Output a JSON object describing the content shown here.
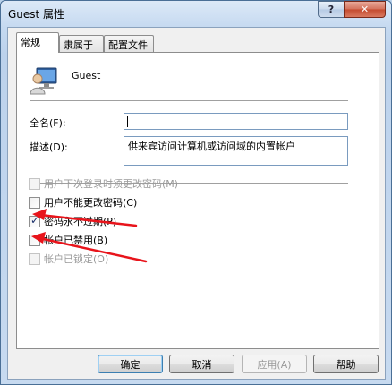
{
  "window": {
    "title": "Guest 属性",
    "help_glyph": "?",
    "close_glyph": "✕"
  },
  "tabs": [
    {
      "label": "常规",
      "active": true
    },
    {
      "label": "隶属于",
      "active": false
    },
    {
      "label": "配置文件",
      "active": false
    }
  ],
  "user": {
    "name": "Guest",
    "icon": "user-account-icon"
  },
  "fields": {
    "fullname_label": "全名(F):",
    "fullname_value": "",
    "description_label": "描述(D):",
    "description_value": "供来宾访问计算机或访问域的内置帐户"
  },
  "checkboxes": [
    {
      "label": "用户下次登录时须更改密码(M)",
      "checked": false,
      "enabled": false
    },
    {
      "label": "用户不能更改密码(C)",
      "checked": false,
      "enabled": true
    },
    {
      "label": "密码永不过期(P)",
      "checked": true,
      "enabled": true
    },
    {
      "label": "帐户已禁用(B)",
      "checked": false,
      "enabled": true
    },
    {
      "label": "帐户已锁定(O)",
      "checked": false,
      "enabled": false
    }
  ],
  "buttons": {
    "ok": "确定",
    "cancel": "取消",
    "apply": "应用(A)",
    "help": "帮助"
  },
  "colors": {
    "annotation_arrow": "#e8141b",
    "window_frame": "#c5d9f0",
    "default_button_border": "#3c7fb1"
  }
}
